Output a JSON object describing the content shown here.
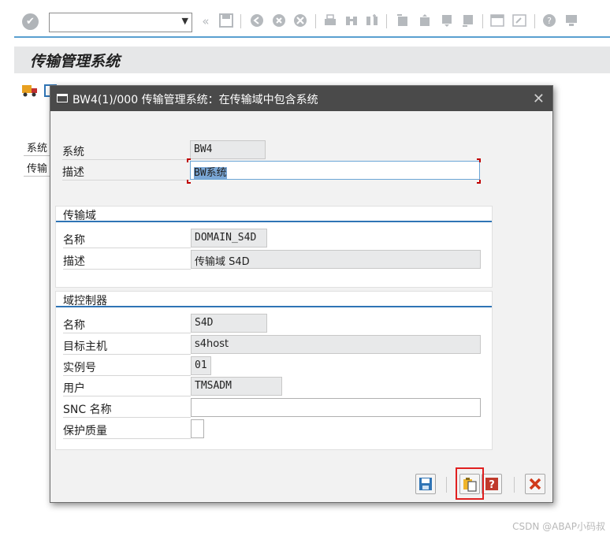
{
  "system_toolbar": {
    "command_field_value": "",
    "icons": [
      "enter-icon",
      "back-icon",
      "save-icon",
      "exit-icon",
      "cancel-icon",
      "print-icon",
      "find-icon",
      "find-next-icon",
      "first-page-icon",
      "previous-page-icon",
      "next-page-icon",
      "last-page-icon",
      "new-session-icon",
      "shortcut-icon",
      "help-icon",
      "customize-layout-icon"
    ]
  },
  "screen": {
    "title": "传输管理系统",
    "labels": [
      "系统",
      "传输"
    ]
  },
  "dialog": {
    "title": "BW4(1)/000 传输管理系统：在传输域中包含系统",
    "fields": {
      "system_label": "系统",
      "system_value": "BW4",
      "description_label": "描述",
      "description_value": "BW系统"
    },
    "transport_domain": {
      "heading": "传输域",
      "name_label": "名称",
      "name_value": "DOMAIN_S4D",
      "desc_label": "描述",
      "desc_value": "传输域 S4D"
    },
    "domain_controller": {
      "heading": "域控制器",
      "name_label": "名称",
      "name_value": "S4D",
      "host_label": "目标主机",
      "host_value": "s4host",
      "instance_label": "实例号",
      "instance_value": "01",
      "user_label": "用户",
      "user_value": "TMSADM",
      "snc_label": "SNC 名称",
      "snc_value": "",
      "protection_label": "保护质量",
      "protection_value": ""
    },
    "footer_buttons": [
      "save-icon",
      "copy-paste-icon",
      "help-icon",
      "cancel-icon"
    ]
  },
  "watermark": "CSDN @ABAP小码叔",
  "colors": {
    "dialog_title_bg": "#4a4a4a",
    "section_underline": "#2f74b5",
    "highlight": "#e02020",
    "selection": "#7aa7d6"
  }
}
